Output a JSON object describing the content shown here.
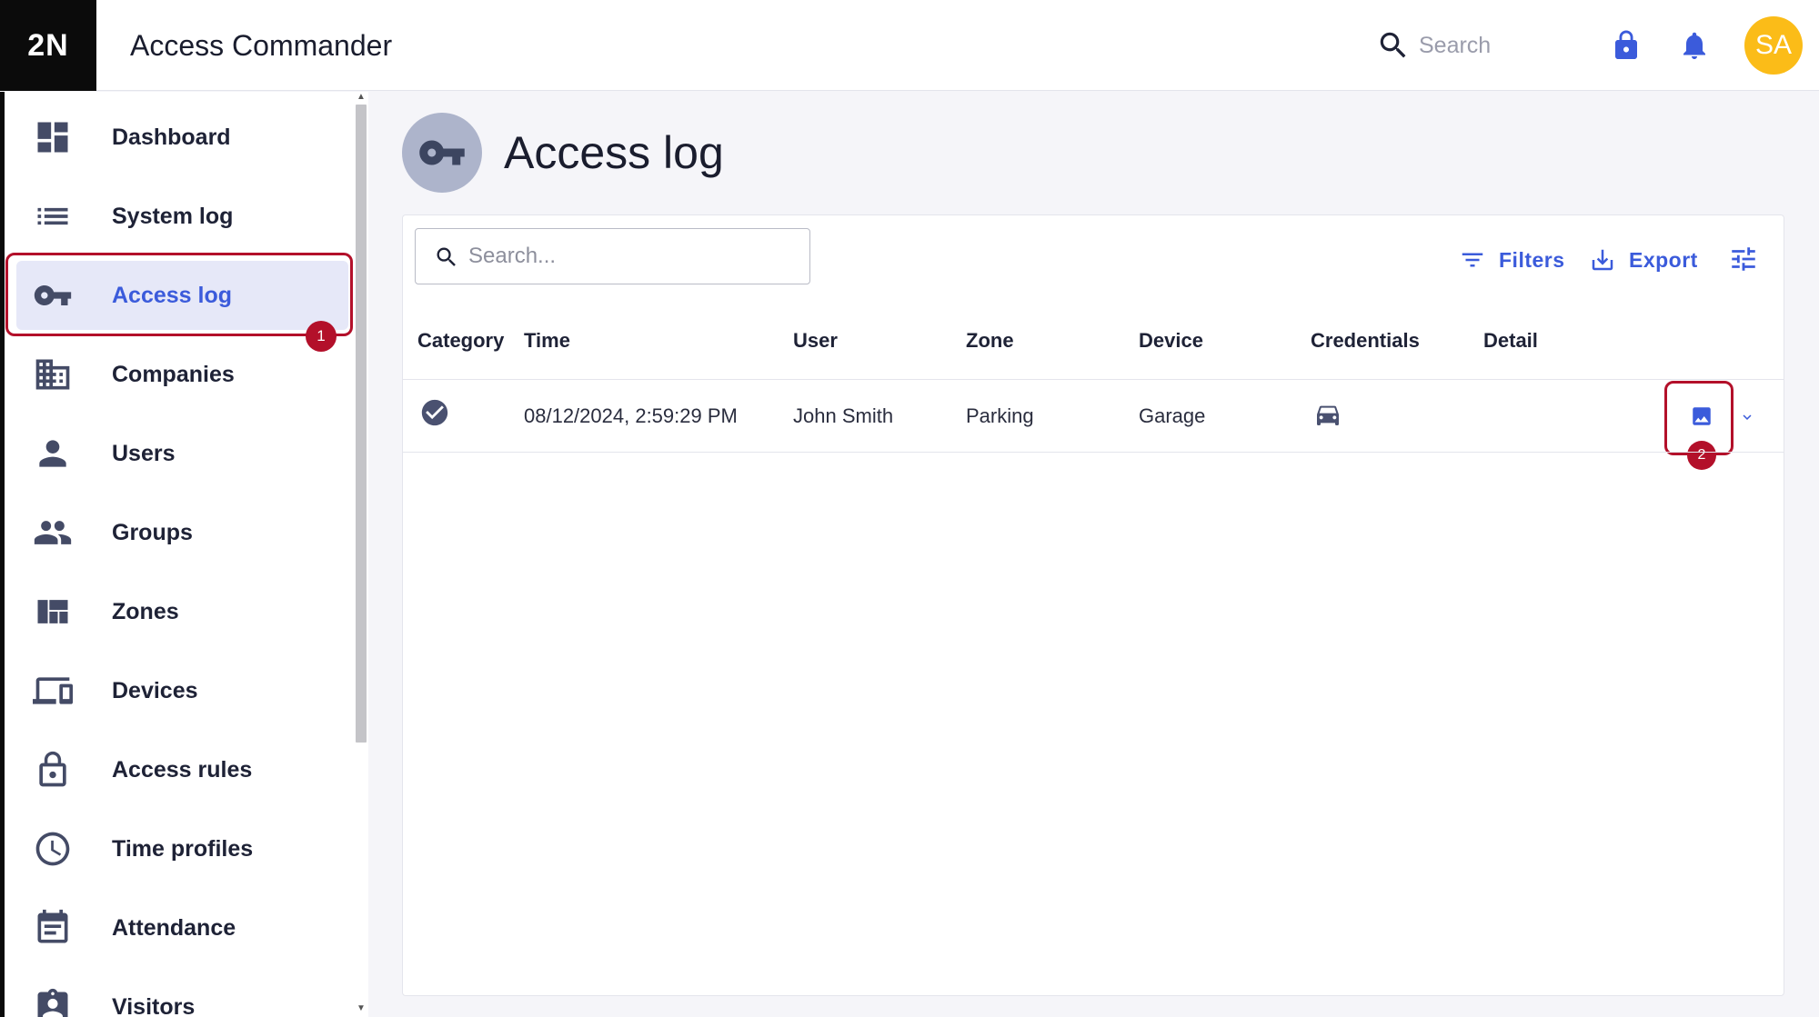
{
  "header": {
    "logo_text": "2N",
    "app_title": "Access Commander",
    "search_placeholder": "Search",
    "avatar_initials": "SA"
  },
  "sidebar": {
    "items": [
      {
        "label": "Dashboard",
        "icon": "dashboard-icon"
      },
      {
        "label": "System log",
        "icon": "list-icon"
      },
      {
        "label": "Access log",
        "icon": "key-icon",
        "active": true
      },
      {
        "label": "Companies",
        "icon": "building-icon"
      },
      {
        "label": "Users",
        "icon": "user-icon"
      },
      {
        "label": "Groups",
        "icon": "group-icon"
      },
      {
        "label": "Zones",
        "icon": "zones-icon"
      },
      {
        "label": "Devices",
        "icon": "devices-icon"
      },
      {
        "label": "Access rules",
        "icon": "lock-outline-icon"
      },
      {
        "label": "Time profiles",
        "icon": "clock-icon"
      },
      {
        "label": "Attendance",
        "icon": "calendar-icon"
      },
      {
        "label": "Visitors",
        "icon": "visitor-icon"
      }
    ]
  },
  "callouts": {
    "one": "1",
    "two": "2"
  },
  "page": {
    "title": "Access log",
    "search_placeholder": "Search...",
    "filters_label": "Filters",
    "export_label": "Export"
  },
  "table": {
    "headers": {
      "category": "Category",
      "time": "Time",
      "user": "User",
      "zone": "Zone",
      "device": "Device",
      "credentials": "Credentials",
      "detail": "Detail"
    },
    "rows": [
      {
        "category_icon": "check-circle-icon",
        "time": "08/12/2024, 2:59:29 PM",
        "user": "John Smith",
        "zone": "Parking",
        "device": "Garage",
        "credentials_icon": "car-icon",
        "detail_icon": "photo-icon"
      }
    ]
  },
  "colors": {
    "accent": "#3b5bdb",
    "callout": "#b3102a",
    "avatar": "#fbbc18",
    "active_bg": "#e6e8f8"
  }
}
